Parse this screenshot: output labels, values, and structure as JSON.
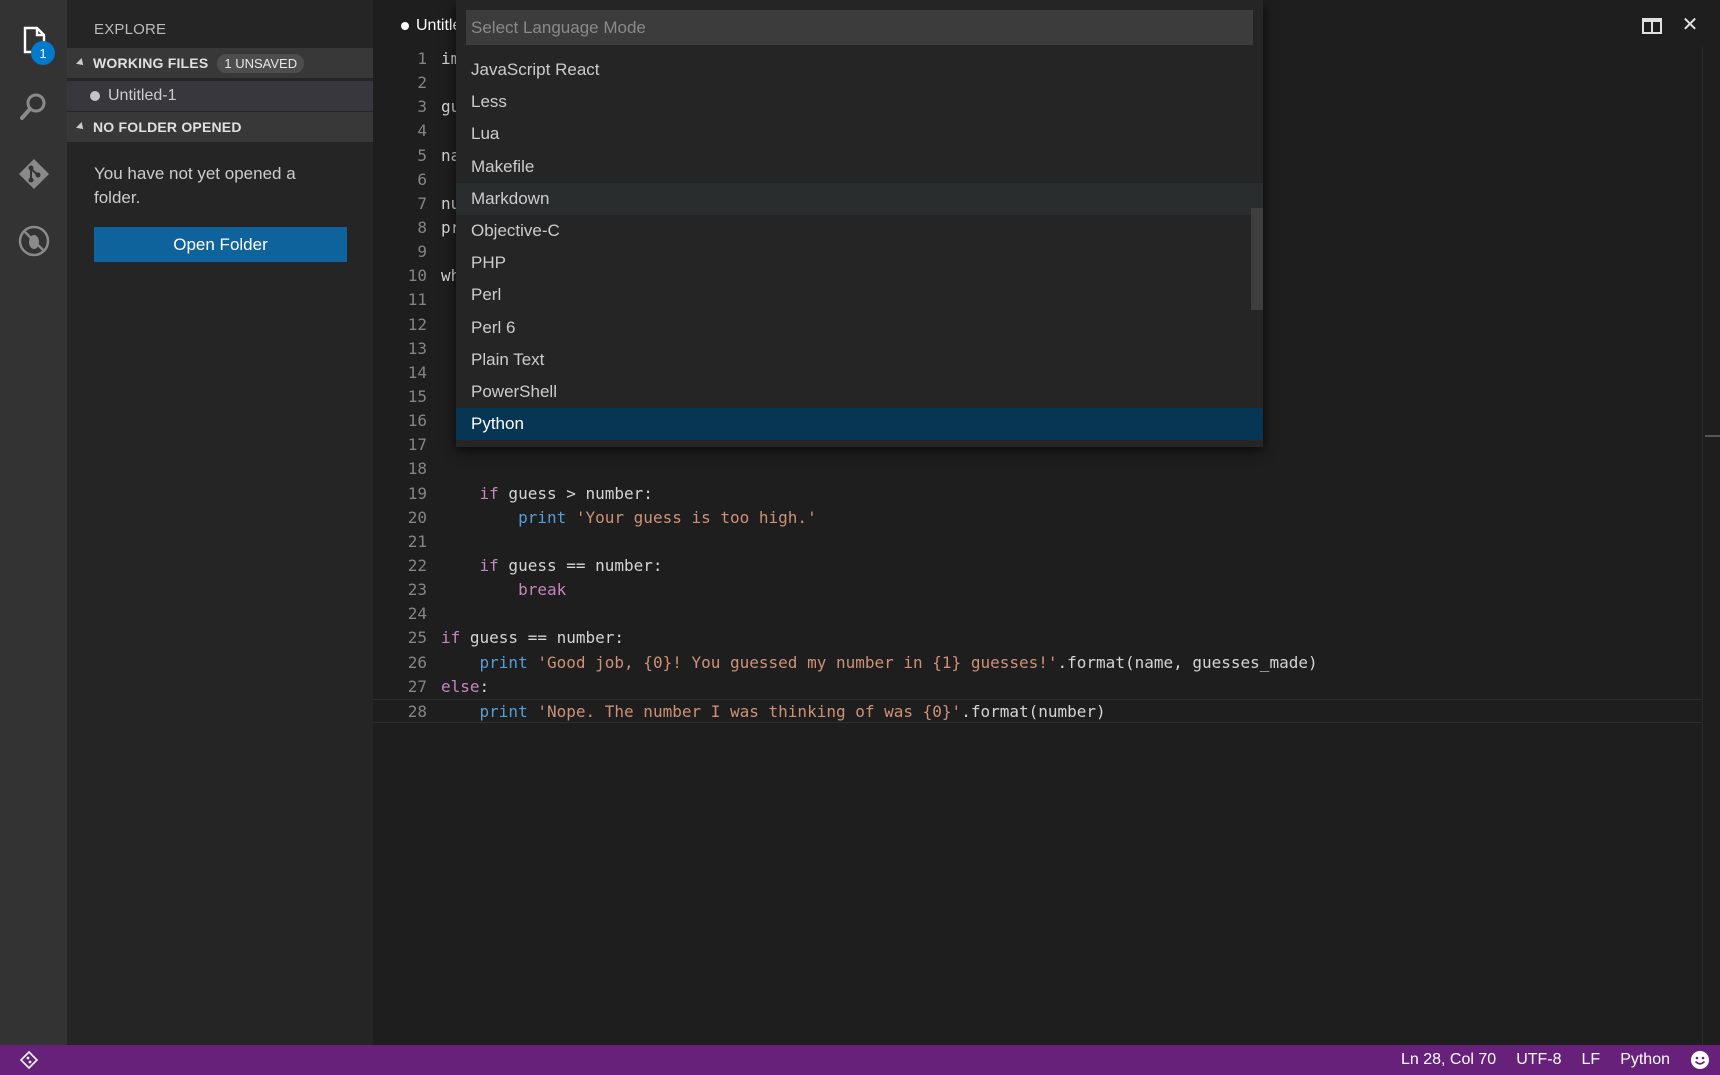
{
  "activity": {
    "explorer_badge": "1"
  },
  "sidebar": {
    "title": "EXPLORE",
    "working_files": {
      "label": "WORKING FILES",
      "badge": "1 UNSAVED",
      "files": [
        "Untitled-1"
      ]
    },
    "no_folder": {
      "label": "NO FOLDER OPENED",
      "message": "You have not yet opened a folder.",
      "button": "Open Folder"
    }
  },
  "editor": {
    "tab_label": "Untitle",
    "lines": [
      {
        "n": "1",
        "t": "im"
      },
      {
        "n": "2",
        "t": ""
      },
      {
        "n": "3",
        "t": "gu"
      },
      {
        "n": "4",
        "t": ""
      },
      {
        "n": "5",
        "t": "na"
      },
      {
        "n": "6",
        "t": ""
      },
      {
        "n": "7",
        "t": "nu"
      },
      {
        "n": "8",
        "t": "pr"
      },
      {
        "n": "9",
        "t": ""
      },
      {
        "n": "10",
        "t": "wh"
      },
      {
        "n": "11",
        "t": ""
      },
      {
        "n": "12",
        "t": ""
      },
      {
        "n": "13",
        "t": ""
      },
      {
        "n": "14",
        "t": ""
      },
      {
        "n": "15",
        "t": ""
      },
      {
        "n": "16",
        "t": ""
      },
      {
        "n": "17",
        "t": ""
      },
      {
        "n": "18",
        "t": ""
      },
      {
        "n": "19",
        "t": "    if guess > number:"
      },
      {
        "n": "20",
        "t": "        print 'Your guess is too high.'"
      },
      {
        "n": "21",
        "t": ""
      },
      {
        "n": "22",
        "t": "    if guess == number:"
      },
      {
        "n": "23",
        "t": "        break"
      },
      {
        "n": "24",
        "t": ""
      },
      {
        "n": "25",
        "t": "if guess == number:"
      },
      {
        "n": "26",
        "t": "    print 'Good job, {0}! You guessed my number in {1} guesses!'.format(name, guesses_made)"
      },
      {
        "n": "27",
        "t": "else:"
      },
      {
        "n": "28",
        "t": "    print 'Nope. The number I was thinking of was {0}'.format(number)"
      }
    ]
  },
  "quickpick": {
    "placeholder": "Select Language Mode",
    "items": [
      "JavaScript React",
      "Less",
      "Lua",
      "Makefile",
      "Markdown",
      "Objective-C",
      "PHP",
      "Perl",
      "Perl 6",
      "Plain Text",
      "PowerShell",
      "Python"
    ],
    "hover_item": "Markdown",
    "selected_item": "Python"
  },
  "statusbar": {
    "position": "Ln 28, Col 70",
    "encoding": "UTF-8",
    "eol": "LF",
    "language": "Python"
  },
  "colors": {
    "accent": "#007acc",
    "statusbar": "#68217a",
    "selection": "#073655",
    "button": "#0e639c"
  }
}
